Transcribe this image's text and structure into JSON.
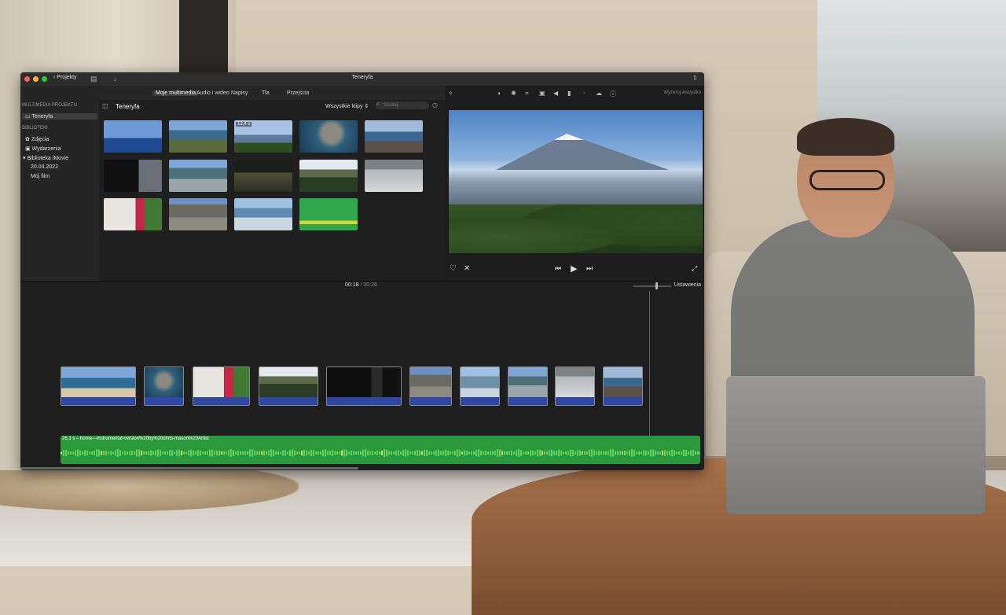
{
  "window": {
    "title": "Teneryfa",
    "projects_label": "Projekty"
  },
  "tabs": [
    "Moje multimedia",
    "Audio i wideo",
    "Napisy",
    "Tła",
    "Przejścia"
  ],
  "sidebar": {
    "project_header": "MULTIMEDIA PROJEKTU",
    "project_item": "Teneryfa",
    "library_header": "BIBLIOTEKI",
    "library_items": [
      "Zdjęcia",
      "Wydarzenia",
      "Biblioteka iMovie",
      "20.04.2022",
      "Mój film"
    ]
  },
  "browser": {
    "title": "Teneryfa",
    "filter_label": "Wszystkie klipy",
    "search_placeholder": "Szukaj",
    "hover_badge": "13,4 s"
  },
  "viewer": {
    "reset_label": "Wyzeruj wszystko"
  },
  "timeline": {
    "current_time": "00:18",
    "separator": " / ",
    "total_time": "00:26",
    "settings_label": "Ustawienia",
    "music_label": "26,1 s – home---instrumental-version%20by%20chris-mason%20Artist"
  },
  "colors": {
    "audio_blue": "#2f48a8",
    "music_green": "#2c9a3c",
    "light_red": "#ff5f57",
    "light_yellow": "#febc2e",
    "light_green": "#28c840"
  },
  "icons": [
    "chevron-left-icon",
    "film-library-icon",
    "download-icon",
    "share-icon",
    "sidebar-toggle-icon",
    "search-icon",
    "clock-icon",
    "magic-wand-icon",
    "color-balance-icon",
    "color-correction-icon",
    "crop-icon",
    "stabilization-icon",
    "volume-icon",
    "equalizer-icon",
    "speed-icon",
    "noise-reduction-icon",
    "info-icon",
    "heart-icon",
    "reject-icon",
    "skip-back-icon",
    "play-icon",
    "skip-forward-icon",
    "fullscreen-icon"
  ]
}
